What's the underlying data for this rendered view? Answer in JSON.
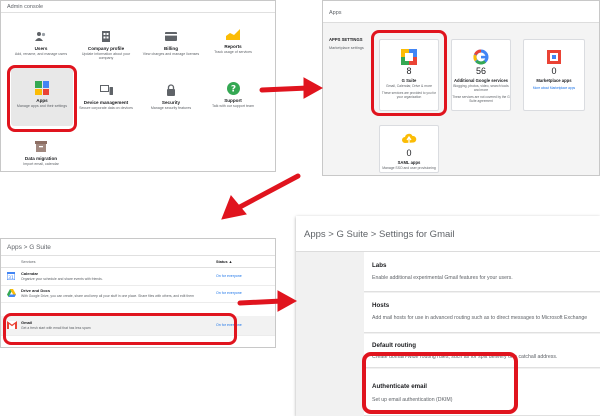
{
  "admin_console": {
    "title": "Admin console",
    "tiles": [
      {
        "key": "users",
        "title": "Users",
        "desc": "Add, rename, and manage users",
        "icon": "users-icon"
      },
      {
        "key": "company",
        "title": "Company profile",
        "desc": "Update information about your company",
        "icon": "building-icon"
      },
      {
        "key": "billing",
        "title": "Billing",
        "desc": "View charges and manage licenses",
        "icon": "billing-icon"
      },
      {
        "key": "reports",
        "title": "Reports",
        "desc": "Track usage of services",
        "icon": "chart-icon"
      },
      {
        "key": "apps",
        "title": "Apps",
        "desc": "Manage apps and their settings",
        "icon": "apps-grid-icon"
      },
      {
        "key": "devices",
        "title": "Device management",
        "desc": "Secure corporate data on devices",
        "icon": "device-icon"
      },
      {
        "key": "security",
        "title": "Security",
        "desc": "Manage security features",
        "icon": "lock-icon"
      },
      {
        "key": "support",
        "title": "Support",
        "desc": "Talk with our support team",
        "icon": "help-icon"
      },
      {
        "key": "migration",
        "title": "Data migration",
        "desc": "Import email, calendar",
        "icon": "archive-icon"
      }
    ]
  },
  "apps_page": {
    "header": "Apps",
    "sidebar_heading": "APPS SETTINGS",
    "sidebar_sub": "Marketplace settings",
    "cards": [
      {
        "key": "gsuite",
        "count": "8",
        "name": "G Suite",
        "desc": "Gmail, Calendar, Drive & more",
        "footer": "These services are provided to you for your organization"
      },
      {
        "key": "google",
        "count": "56",
        "name": "Additional Google services",
        "desc": "Blogging, photos, video, search tools and more",
        "footer": "These services are not covered by the G Suite agreement"
      },
      {
        "key": "marketplace",
        "count": "0",
        "name": "Marketplace apps",
        "desc": "",
        "footer": "More about Marketplace apps"
      },
      {
        "key": "saml",
        "count": "0",
        "name": "SAML apps",
        "desc": "Manage SSO and user provisioning",
        "footer": ""
      }
    ]
  },
  "gsuite_page": {
    "breadcrumb": "Apps  >  G Suite",
    "col_services": "Services",
    "col_status": "Status ▲",
    "rows": [
      {
        "key": "calendar",
        "name": "Calendar",
        "desc": "Organize your schedule and share events with friends.",
        "status": "On for everyone"
      },
      {
        "key": "drive",
        "name": "Drive and Docs",
        "desc": "With Google Drive, you can create, share and keep all your stuff in one place. Share files with others, and edit them",
        "status": "On for everyone"
      },
      {
        "key": "gmail",
        "name": "Gmail",
        "desc": "Get a fresh start with email that has less spam",
        "status": "On for everyone"
      }
    ]
  },
  "gmail_settings": {
    "breadcrumb": "Apps  >  G Suite  >  Settings for Gmail",
    "sections": [
      {
        "key": "labs",
        "title": "Labs",
        "desc": "Enable additional experimental Gmail features for your users."
      },
      {
        "key": "hosts",
        "title": "Hosts",
        "desc": "Add mail hosts for use in advanced routing such as to direct messages to Microsoft Exchange"
      },
      {
        "key": "routing",
        "title": "Default routing",
        "desc": "Create domain-wide routing rules, such as for split delivery or a catchall address."
      },
      {
        "key": "auth",
        "title": "Authenticate email",
        "desc": "Set up email authentication (DKIM)"
      }
    ]
  },
  "colors": {
    "highlight": "#e0141e",
    "link": "#1a73e8"
  }
}
